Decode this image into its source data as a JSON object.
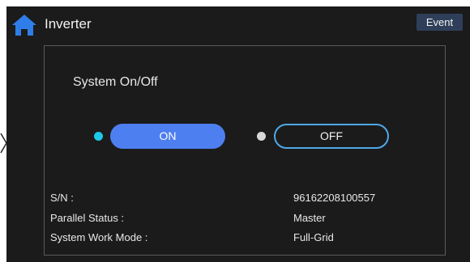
{
  "header": {
    "title": "Inverter",
    "event_label": "Event",
    "home_icon": "home-icon"
  },
  "panel": {
    "section_title": "System On/Off",
    "on_label": "ON",
    "off_label": "OFF",
    "on_indicator_color": "#1dc8e8",
    "off_indicator_color": "#d8d8d8",
    "selected": "ON"
  },
  "info": [
    {
      "label": "S/N :",
      "value": "96162208100557"
    },
    {
      "label": "Parallel Status :",
      "value": "Master"
    },
    {
      "label": "System Work Mode :",
      "value": "Full-Grid"
    }
  ],
  "colors": {
    "background": "#1b1b1b",
    "accent": "#4e7ff0",
    "home_icon": "#2f7de8"
  }
}
